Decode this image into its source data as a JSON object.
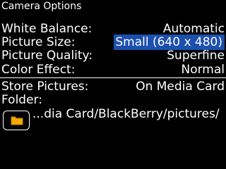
{
  "window": {
    "title": "Camera Options"
  },
  "options": [
    {
      "label": "White Balance:",
      "value": "Automatic",
      "selected": false
    },
    {
      "label": "Picture Size:",
      "value": "Small (640 x 480)",
      "selected": true
    },
    {
      "label": "Picture Quality:",
      "value": "Superfine",
      "selected": false
    },
    {
      "label": "Color Effect:",
      "value": "Normal",
      "selected": false
    }
  ],
  "storage": {
    "label": "Store Pictures:",
    "value": "On Media Card"
  },
  "folder": {
    "label": "Folder:",
    "path": "...dia Card/BlackBerry/pictures/",
    "icon": "folder-icon",
    "icon_color": "#f5a800"
  },
  "colors": {
    "background": "#000000",
    "text": "#ffffff",
    "selection": "#1c4fae"
  }
}
